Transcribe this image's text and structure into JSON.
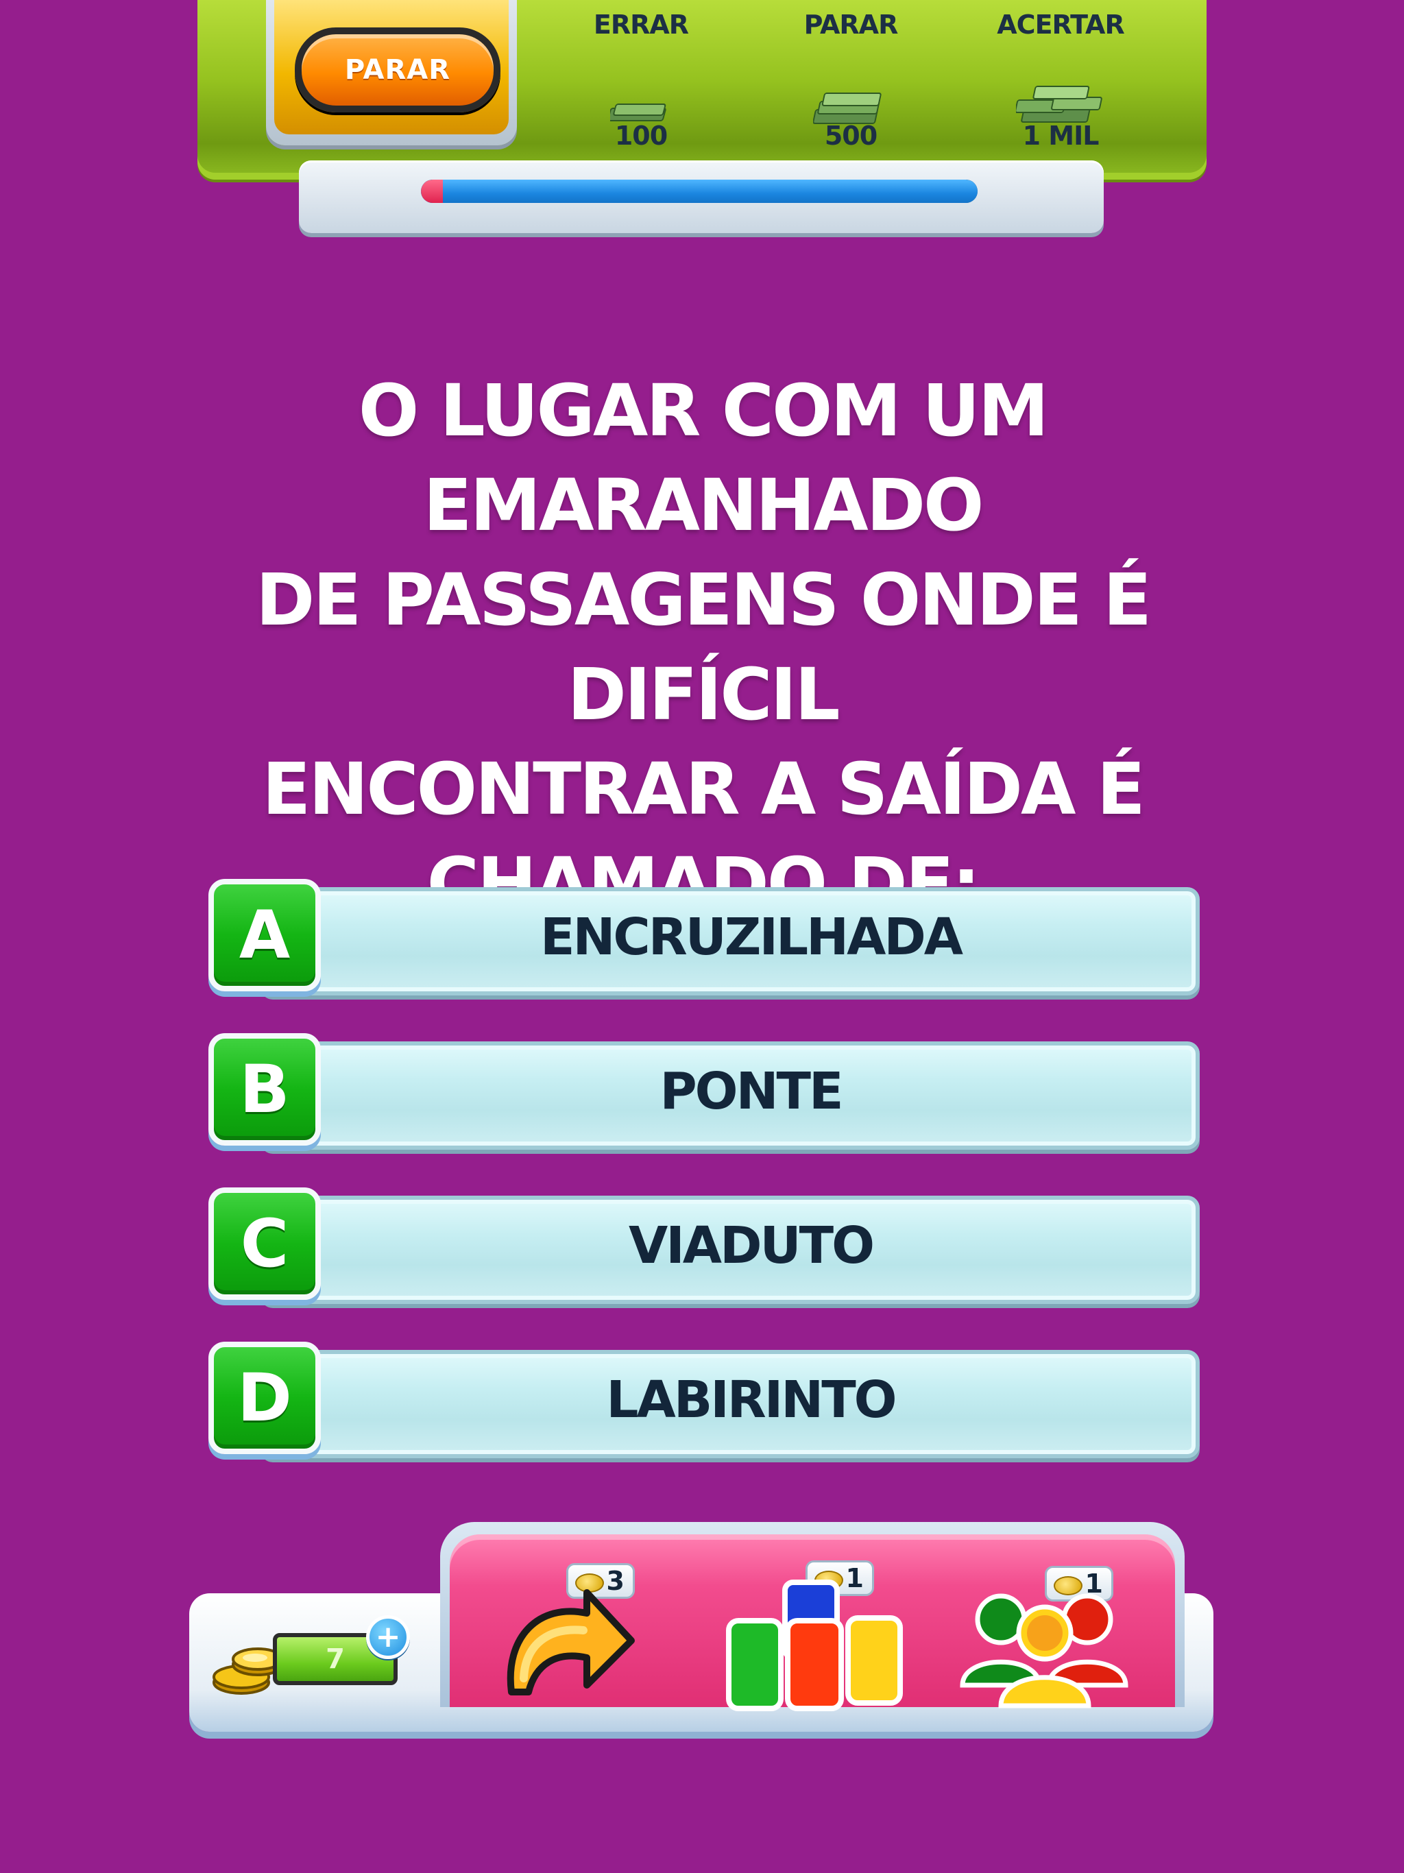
{
  "stop_button": {
    "label": "PARAR"
  },
  "prizes": [
    {
      "label": "ERRAR",
      "amount": "100"
    },
    {
      "label": "PARAR",
      "amount": "500"
    },
    {
      "label": "ACERTAR",
      "amount": "1 MIL"
    }
  ],
  "timer": {
    "remaining_fraction": 0.96
  },
  "question": {
    "lines": [
      "O LUGAR COM UM EMARANHADO",
      "DE PASSAGENS ONDE É DIFÍCIL",
      "ENCONTRAR A SAÍDA É",
      "CHAMADO DE:"
    ]
  },
  "answers": [
    {
      "letter": "A",
      "text": "ENCRUZILHADA"
    },
    {
      "letter": "B",
      "text": "PONTE"
    },
    {
      "letter": "C",
      "text": "VIADUTO"
    },
    {
      "letter": "D",
      "text": "LABIRINTO"
    }
  ],
  "coins": {
    "balance": "7",
    "add_icon": "plus-icon"
  },
  "helps": [
    {
      "icon": "skip-arrow-icon",
      "cost": "3"
    },
    {
      "icon": "cards-icon",
      "cost": "1"
    },
    {
      "icon": "audience-icon",
      "cost": "1"
    }
  ],
  "colors": {
    "background": "#951e8d",
    "answer_letter": "#14b514",
    "help_panel": "#e02f74",
    "top_panel": "#95c21f"
  }
}
